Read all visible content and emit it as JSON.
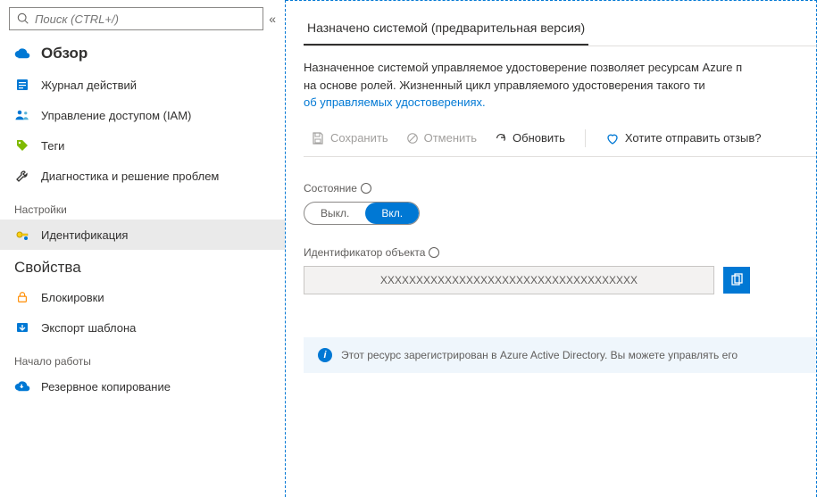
{
  "search": {
    "placeholder": "Поиск (CTRL+/)"
  },
  "nav": {
    "overview": "Обзор",
    "activity": "Журнал действий",
    "iam": "Управление доступом (IAM)",
    "tags": "Теги",
    "diagnose": "Диагностика и решение проблем",
    "section_settings": "Настройки",
    "identity": "Идентификация",
    "properties_head": "Свойства",
    "locks": "Блокировки",
    "export": "Экспорт шаблона",
    "section_started": "Начало работы",
    "backup": "Резервное копирование"
  },
  "tab": {
    "system": "Назначено системой (предварительная версия)"
  },
  "desc": {
    "line1": "Назначенное системой управляемое удостоверение позволяет ресурсам Azure п",
    "line2": "на основе ролей. Жизненный цикл управляемого удостоверения такого ти",
    "link": "об управляемых удостоверениях."
  },
  "toolbar": {
    "save": "Сохранить",
    "cancel": "Отменить",
    "refresh": "Обновить",
    "feedback": "Хотите отправить отзыв?"
  },
  "status": {
    "label": "Состояние",
    "off": "Выкл.",
    "on": "Вкл."
  },
  "objectid": {
    "label": "Идентификатор объекта",
    "value": "XXXXXXXXXXXXXXXXXXXXXXXXXXXXXXXXXXXX"
  },
  "banner": "Этот ресурс зарегистрирован в Azure Active Directory. Вы можете управлять его"
}
